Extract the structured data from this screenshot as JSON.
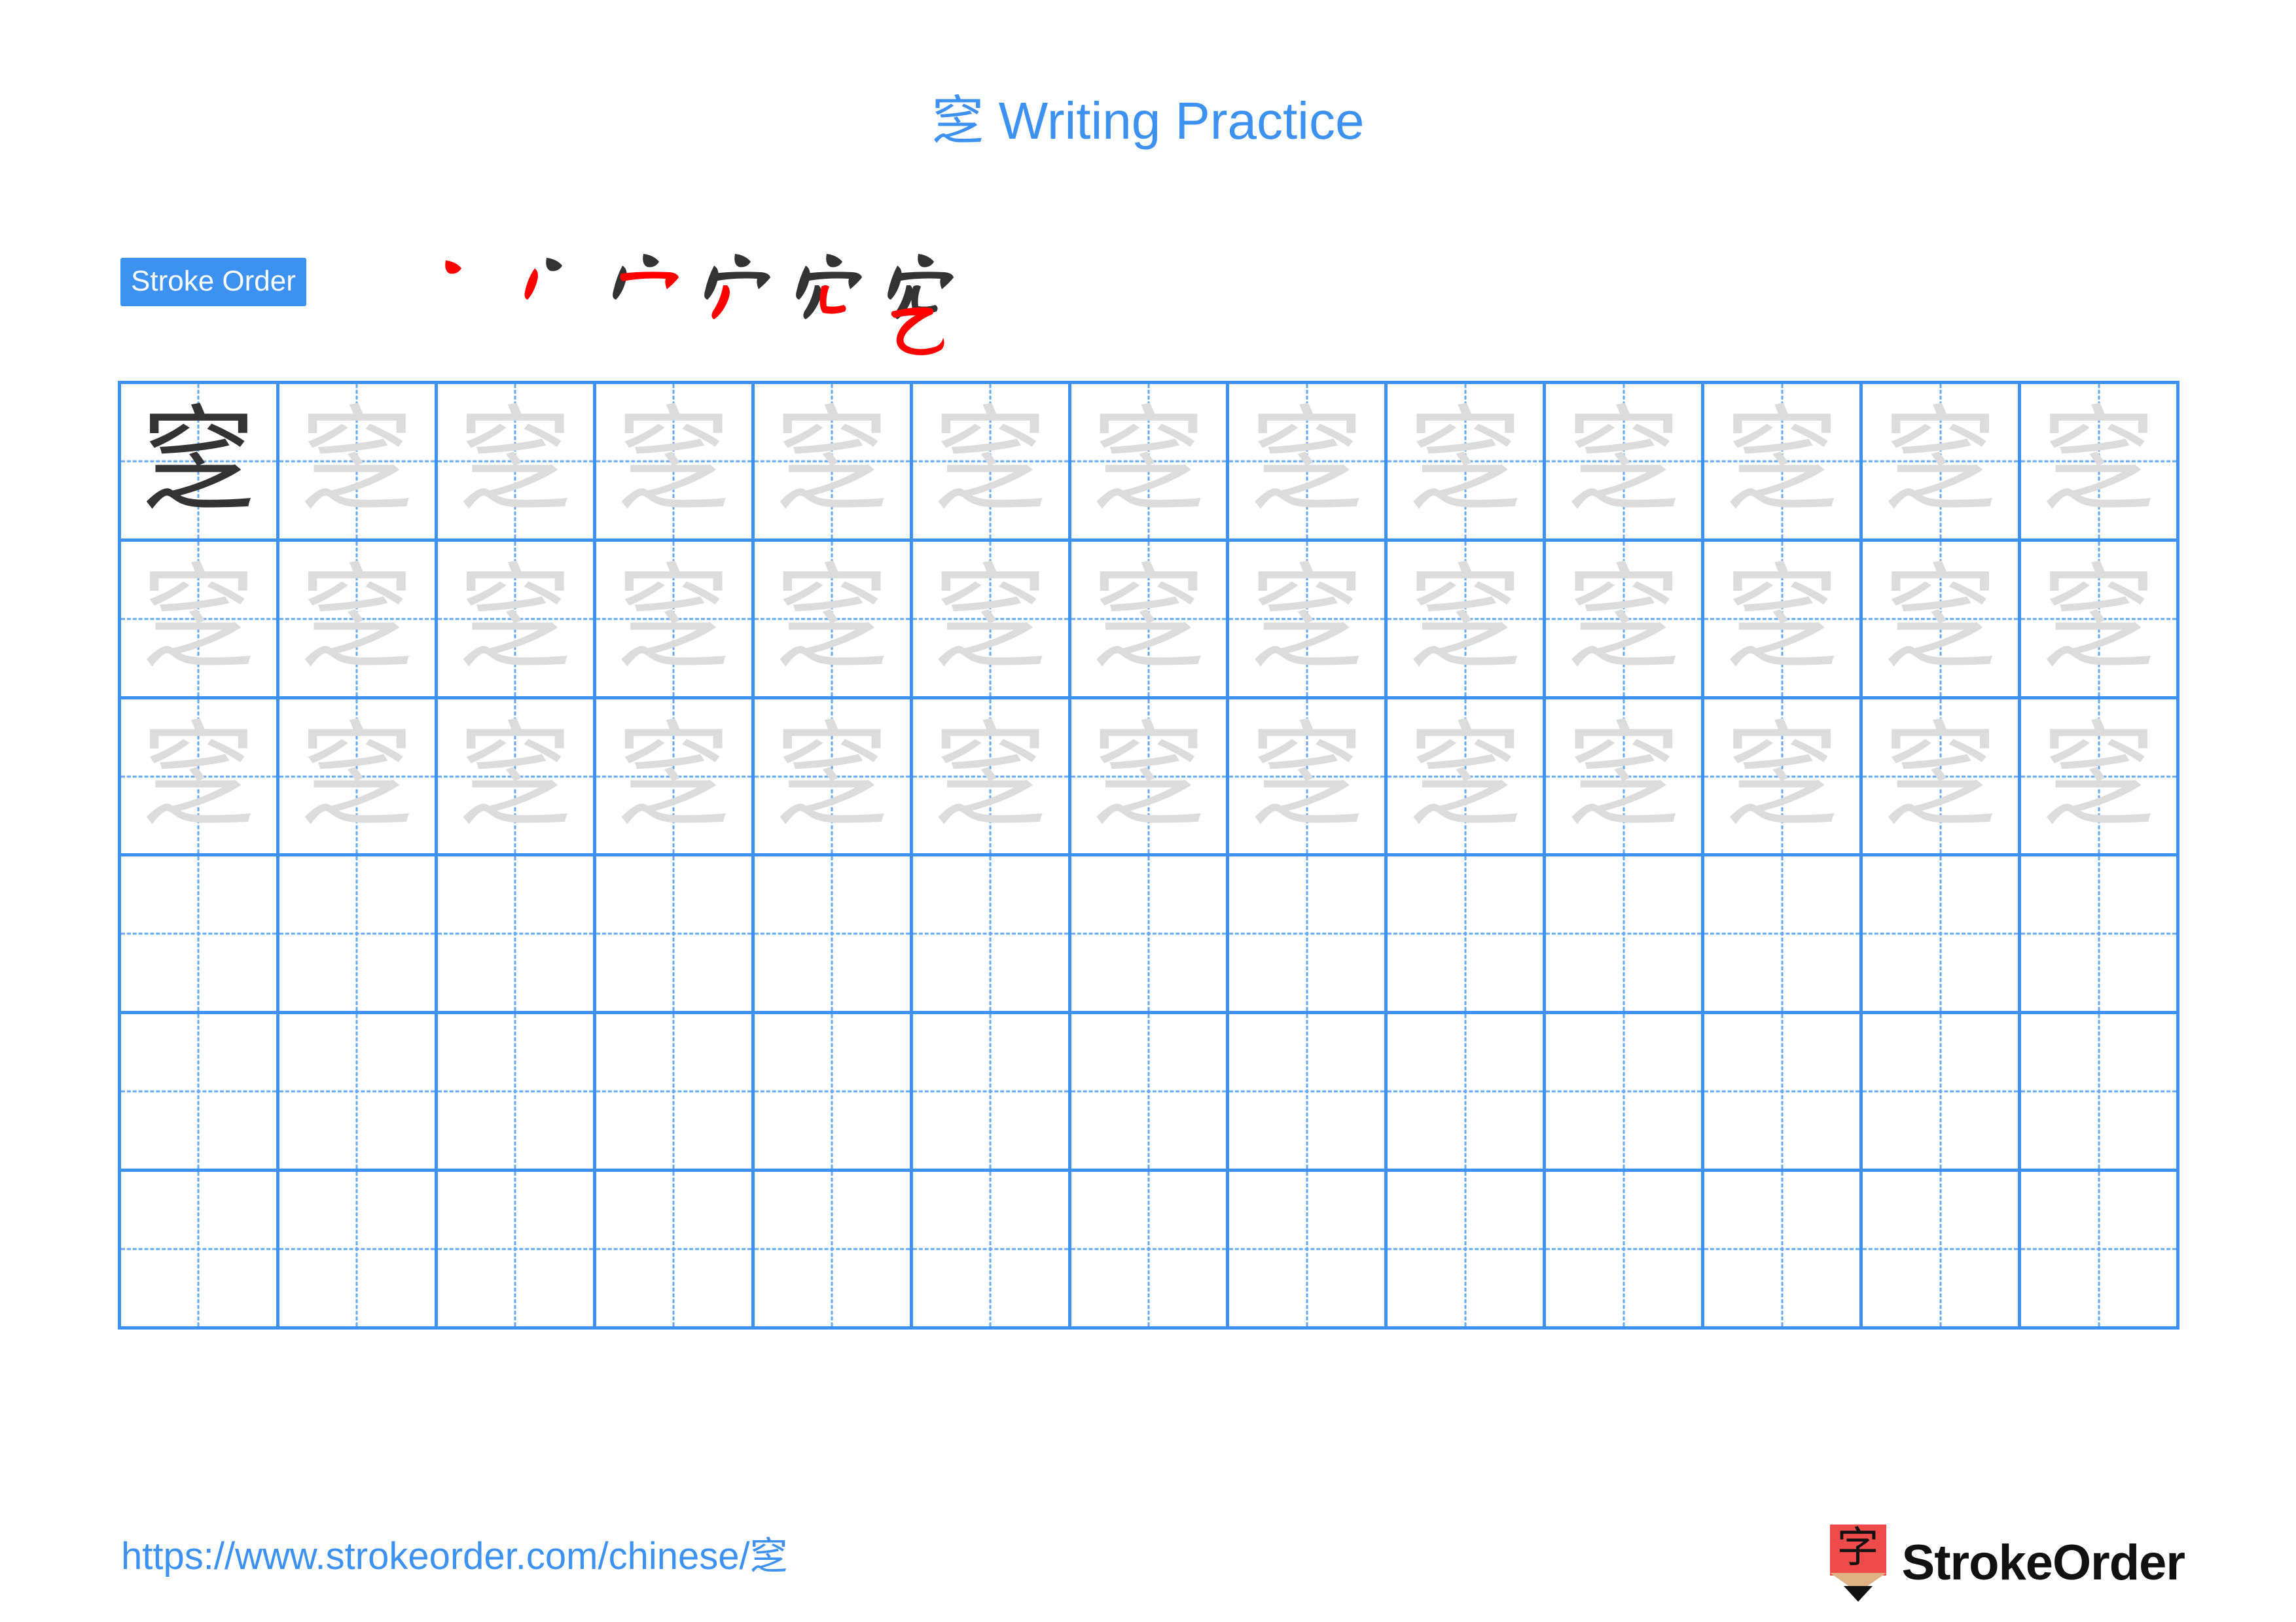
{
  "page": {
    "character": "窆",
    "title_suffix": " Writing Practice",
    "title_full": "窆 Writing Practice",
    "background_color": "#ffffff",
    "accent_color": "#3d91f0",
    "trace_color": "#dcdcdc",
    "ink_color": "#333333",
    "highlight_stroke_color": "#ff0000"
  },
  "stroke_order": {
    "badge_label": "Stroke Order",
    "badge_background": "#3d91f0",
    "badge_text_color": "#ffffff",
    "step_count": 6,
    "steps": [
      {
        "index": 1,
        "stroke_name": "dot",
        "new_stroke_color": "#ff0000"
      },
      {
        "index": 2,
        "stroke_name": "left-falling-dot",
        "new_stroke_color": "#ff0000"
      },
      {
        "index": 3,
        "stroke_name": "horizontal-hook",
        "new_stroke_color": "#ff0000"
      },
      {
        "index": 4,
        "stroke_name": "left-falling",
        "new_stroke_color": "#ff0000"
      },
      {
        "index": 5,
        "stroke_name": "horizontal-fold",
        "new_stroke_color": "#ff0000"
      },
      {
        "index": 6,
        "stroke_name": "horizontal-bend-hook",
        "new_stroke_color": "#ff0000"
      }
    ]
  },
  "practice_grid": {
    "columns": 13,
    "rows": 6,
    "border_color": "#3d91f0",
    "guide_line_color": "#66a9f3",
    "cells": [
      [
        "dark",
        "trace",
        "trace",
        "trace",
        "trace",
        "trace",
        "trace",
        "trace",
        "trace",
        "trace",
        "trace",
        "trace",
        "trace"
      ],
      [
        "trace",
        "trace",
        "trace",
        "trace",
        "trace",
        "trace",
        "trace",
        "trace",
        "trace",
        "trace",
        "trace",
        "trace",
        "trace"
      ],
      [
        "trace",
        "trace",
        "trace",
        "trace",
        "trace",
        "trace",
        "trace",
        "trace",
        "trace",
        "trace",
        "trace",
        "trace",
        "trace"
      ],
      [
        "empty",
        "empty",
        "empty",
        "empty",
        "empty",
        "empty",
        "empty",
        "empty",
        "empty",
        "empty",
        "empty",
        "empty",
        "empty"
      ],
      [
        "empty",
        "empty",
        "empty",
        "empty",
        "empty",
        "empty",
        "empty",
        "empty",
        "empty",
        "empty",
        "empty",
        "empty",
        "empty"
      ],
      [
        "empty",
        "empty",
        "empty",
        "empty",
        "empty",
        "empty",
        "empty",
        "empty",
        "empty",
        "empty",
        "empty",
        "empty",
        "empty"
      ]
    ]
  },
  "footer": {
    "url": "https://www.strokeorder.com/chinese/窆",
    "brand_name": "StrokeOrder",
    "logo_character": "字",
    "logo_color": "#ef4b4b",
    "logo_wood_color": "#e0b183",
    "logo_tip_color": "#111111"
  }
}
